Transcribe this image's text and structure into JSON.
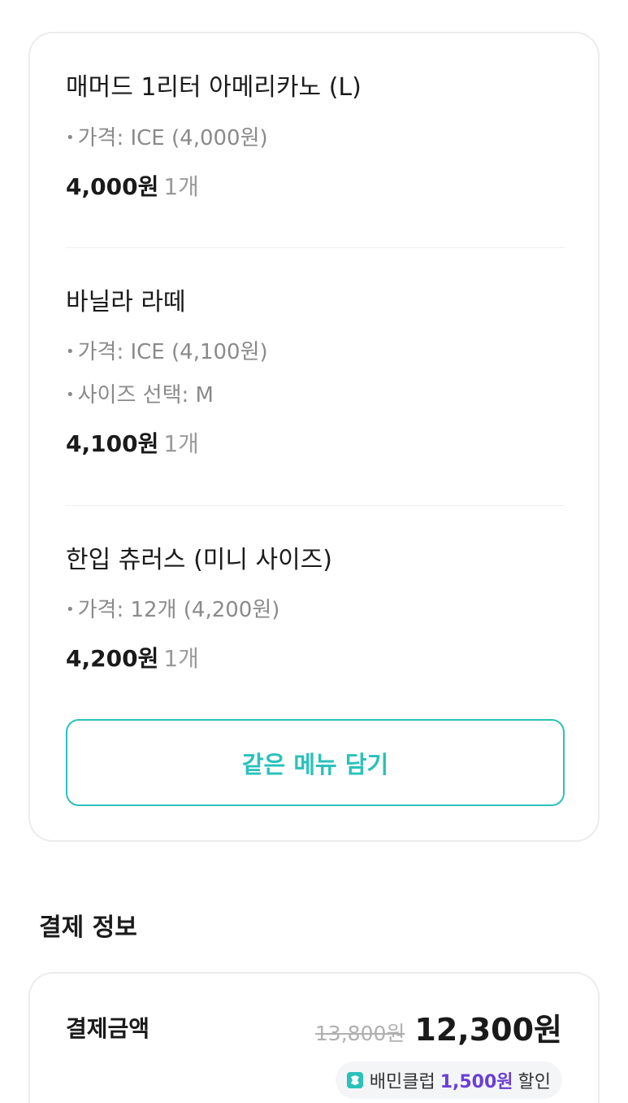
{
  "cart": {
    "items": [
      {
        "name": "매머드 1리터 아메리카노 (L)",
        "options": [
          "가격: ICE (4,000원)"
        ],
        "price": "4,000원",
        "qty": "1개"
      },
      {
        "name": "바닐라 라떼",
        "options": [
          "가격: ICE (4,100원)",
          "사이즈 선택: M"
        ],
        "price": "4,100원",
        "qty": "1개"
      },
      {
        "name": "한입 츄러스 (미니 사이즈)",
        "options": [
          "가격: 12개 (4,200원)"
        ],
        "price": "4,200원",
        "qty": "1개"
      }
    ],
    "add_same_label": "같은 메뉴 담기"
  },
  "payment": {
    "section_title": "결제 정보",
    "amount_label": "결제금액",
    "original_price": "13,800원",
    "final_price": "12,300원",
    "club_badge": {
      "prefix": "배민클럽",
      "amount": "1,500원",
      "suffix": "할인",
      "icon": "baemin-club-icon"
    }
  },
  "colors": {
    "accent": "#2ac1bc",
    "club_purple": "#6a3fd6",
    "muted": "#8a8a8a"
  }
}
